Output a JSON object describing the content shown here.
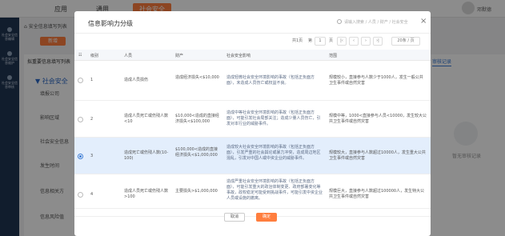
{
  "topnav": {
    "item1": "应用",
    "item2": "通用",
    "item3": "社会安全",
    "user": "邓默德"
  },
  "sidebar": {
    "items": [
      "社会安全信息编辑",
      "社会安全信息维护",
      "社会安全信息审核"
    ]
  },
  "bg": {
    "crumb": "安全信息填写列表",
    "add_button": "新增",
    "left_header": "拟重要信息填写列表",
    "section": "社会安全",
    "rows": [
      "填报公司",
      "影响区域",
      "社会安全信息",
      "发生时间",
      "信息相关方",
      "信息风险值"
    ],
    "right_tab": "审核记录",
    "right_empty": "暂无审核记录"
  },
  "modal": {
    "title": "信息影响力分级",
    "search_placeholder": "请输入搜索 / 人员 / 财产 / 社会安全",
    "close": "×",
    "pager": {
      "total": "共1页",
      "page_prefix": "第",
      "page": "1",
      "page_suffix": "页",
      "per_page": "20条 / 页"
    },
    "columns": [
      "级别",
      "人员",
      "财产",
      "社会安全影响",
      "范围"
    ],
    "rows": [
      {
        "level": "1",
        "person": "造成人员损伤",
        "property": "造成经济损失<$10,000",
        "social": "造成轻微社会安全环境影响的事故（包括正负面方面），未造成人员伤亡或权益不良。",
        "scope": "规模较小，直接参与人数少于1000人，发生一般公共卫生事件或自然灾害",
        "selected": false
      },
      {
        "level": "2",
        "person": "造成人员死亡或伤残人数<10",
        "property": "$10,000<造成的直接经济损失<$100,000",
        "social": "造成中等社会安全环境影响的事故（包括正负面方面），可能引发社会局部关注；造成少量人员伤亡，引发对本行业的威胁事件。",
        "scope": "规模中等，1000<直接参与人员<10000，发生较大公共卫生事件或自然灾害",
        "selected": false
      },
      {
        "level": "3",
        "person": "造成死亡或伤残人数(10-100)",
        "property": "$100,000<造成的直接经济损失<$1,000,000",
        "social": "造成较大社会安全环境影响的事故（包括正负面方面），引发严重的社会舆论或暴力冲突，造成周边地区混乱，引发对中国人或中资企业的威胁事件。",
        "scope": "规模较大，直接参与人数超过10000人，发生重大公共卫生事件或自然灾害",
        "selected": true
      },
      {
        "level": "4",
        "person": "造成人员死亡或伤残人数>100",
        "property": "主要损失>$1,000,000",
        "social": "造成严重社会安全环境影响的事故（包括正负面方面），可能引发重大的政治体制变更、政府部署变化等事故，政权稳定可能受到挑战事件，可能引发中资企业人员或设施的撤离。",
        "scope": "规模巨大，直接参与人数超过100000人，发生特大公共卫生事件或自然灾害",
        "selected": false
      }
    ],
    "cancel": "取消",
    "ok": "确定"
  }
}
